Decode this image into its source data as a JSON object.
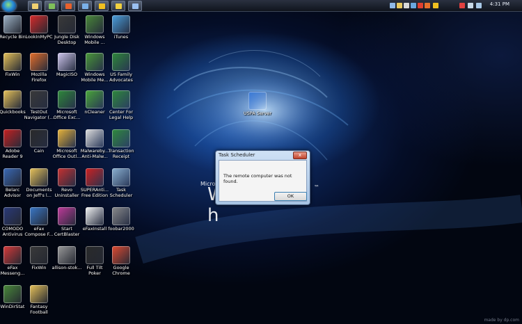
{
  "taskbar": {
    "clock": "4:31 PM",
    "quick_launch": [
      {
        "name": "show-desktop",
        "icon": "desktop-icon",
        "color": "#f0d070"
      },
      {
        "name": "mycomputer",
        "icon": "computer-icon",
        "color": "#7fc05a"
      },
      {
        "name": "firefox",
        "icon": "firefox-icon",
        "color": "#e8612c"
      },
      {
        "name": "ftp",
        "icon": "network-icon",
        "color": "#7ab0e8"
      },
      {
        "name": "runner",
        "icon": "runner-icon",
        "color": "#f0c020"
      },
      {
        "name": "favorites",
        "icon": "star-icon",
        "color": "#f0d040"
      },
      {
        "name": "switch-windows",
        "icon": "windows-icon",
        "color": "#9ac0f0"
      }
    ],
    "tray": [
      {
        "icon": "monitor-icon",
        "color": "#8fb8e8"
      },
      {
        "icon": "folder-icon",
        "color": "#e8c860"
      },
      {
        "icon": "document-icon",
        "color": "#d8d8d8"
      },
      {
        "icon": "network-icon",
        "color": "#6aa8e0"
      },
      {
        "icon": "chrome-icon",
        "color": "#e04030"
      },
      {
        "icon": "firefox-icon",
        "color": "#e8702c"
      },
      {
        "icon": "runner-icon",
        "color": "#f0c020"
      },
      {
        "icon": "flag-icon",
        "color": "#e04040"
      },
      {
        "icon": "speaker-icon",
        "color": "#c8d8e8"
      },
      {
        "icon": "network-tray-icon",
        "color": "#a8c8e8"
      }
    ]
  },
  "desktop": {
    "icons": [
      {
        "label1": "Recycle Bin",
        "label2": "",
        "icon": "recycle-bin-icon",
        "color": "#9fb4c8"
      },
      {
        "label1": "LookInMyPC",
        "label2": "",
        "icon": "lookinmypc-icon",
        "color": "#d92a2a"
      },
      {
        "label1": "Jungle Disk",
        "label2": "Desktop",
        "icon": "jungle-disk-icon",
        "color": "#3a3a3a"
      },
      {
        "label1": "Windows",
        "label2": "Mobile ...",
        "icon": "windows-mobile-icon",
        "color": "#4a8a3a"
      },
      {
        "label1": "iTunes",
        "label2": "",
        "icon": "itunes-icon",
        "color": "#4aa0e0"
      },
      {
        "label1": "FixWin",
        "label2": "",
        "icon": "folder-icon",
        "color": "#e8c35a"
      },
      {
        "label1": "Mozilla",
        "label2": "Firefox",
        "icon": "firefox-icon",
        "color": "#e8702c"
      },
      {
        "label1": "MagicISO",
        "label2": "",
        "icon": "magiciso-icon",
        "color": "#d0c8f0"
      },
      {
        "label1": "Windows",
        "label2": "Mobile Me...",
        "icon": "windows-mobile-icon",
        "color": "#4a9a3a"
      },
      {
        "label1": "US Family",
        "label2": "Advocates",
        "icon": "excel-icon",
        "color": "#2f8a3c"
      },
      {
        "label1": "Quickbooks",
        "label2": "",
        "icon": "folder-icon",
        "color": "#e8c35a"
      },
      {
        "label1": "TestOut",
        "label2": "Navigator (...",
        "icon": "testout-icon",
        "color": "#3a3a3a"
      },
      {
        "label1": "Microsoft",
        "label2": "Office Exc...",
        "icon": "excel-icon",
        "color": "#2f8a3c"
      },
      {
        "label1": "nCleaner",
        "label2": "",
        "icon": "ncleaner-icon",
        "color": "#4aa83a"
      },
      {
        "label1": "Center For",
        "label2": "Legal Help",
        "icon": "excel-icon",
        "color": "#2f8a3c"
      },
      {
        "label1": "Adobe",
        "label2": "Reader 9",
        "icon": "adobe-reader-icon",
        "color": "#c82020"
      },
      {
        "label1": "Cain",
        "label2": "",
        "icon": "cain-icon",
        "color": "#2a2a2a"
      },
      {
        "label1": "Microsoft",
        "label2": "Office Outl...",
        "icon": "outlook-icon",
        "color": "#e8b43a"
      },
      {
        "label1": "Malwareby...",
        "label2": "Anti-Malw...",
        "icon": "malwarebytes-icon",
        "color": "#e0e0e0"
      },
      {
        "label1": "Transaction",
        "label2": "Receipt",
        "icon": "excel-icon",
        "color": "#2f8a3c"
      },
      {
        "label1": "Belarc",
        "label2": "Advisor",
        "icon": "belarc-icon",
        "color": "#3a6ab8"
      },
      {
        "label1": "Documents",
        "label2": "on Jeff's l...",
        "icon": "folder-icon",
        "color": "#e8c35a"
      },
      {
        "label1": "Revo",
        "label2": "Uninstaller",
        "icon": "revo-icon",
        "color": "#c83030"
      },
      {
        "label1": "SUPERAnti...",
        "label2": "Free Edition",
        "icon": "superantispyware-icon",
        "color": "#d02020"
      },
      {
        "label1": "Task",
        "label2": "Scheduler",
        "icon": "task-scheduler-icon",
        "color": "#8ab0d0"
      },
      {
        "label1": "COMODO",
        "label2": "Antivirus",
        "icon": "comodo-icon",
        "color": "#2a3a7a"
      },
      {
        "label1": "eFax",
        "label2": "Compose F...",
        "icon": "efax-icon",
        "color": "#3a78c8"
      },
      {
        "label1": "Start",
        "label2": "CertBlaster",
        "icon": "certblaster-icon",
        "color": "#c03a9a"
      },
      {
        "label1": "eFaxInstall",
        "label2": "",
        "icon": "document-icon",
        "color": "#f4f4f4"
      },
      {
        "label1": "foobar2000",
        "label2": "",
        "icon": "foobar-icon",
        "color": "#8a8a8a"
      },
      {
        "label1": "eFax",
        "label2": "Messeng...",
        "icon": "efax-messenger-icon",
        "color": "#d83a3a"
      },
      {
        "label1": "FixWin",
        "label2": "",
        "icon": "fixwin-icon",
        "color": "#3a3a3a"
      },
      {
        "label1": "allison-stok...",
        "label2": "",
        "icon": "image-icon",
        "color": "#9a9a9a"
      },
      {
        "label1": "Full Tilt",
        "label2": "Poker",
        "icon": "full-tilt-icon",
        "color": "#2a2a2a"
      },
      {
        "label1": "Google",
        "label2": "Chrome",
        "icon": "chrome-icon",
        "color": "#e04a30"
      },
      {
        "label1": "WinDirStat",
        "label2": "",
        "icon": "windirstat-icon",
        "color": "#4a8a3a"
      },
      {
        "label1": "Fantasy",
        "label2": "Football",
        "icon": "folder-icon",
        "color": "#e8c35a"
      },
      {
        "label1": "USPA Server",
        "label2": "",
        "icon": "computer-icon",
        "color": "#3a7ad8"
      }
    ]
  },
  "wallpaper": {
    "brand_small": "Micro",
    "brand_big": "W                h",
    "trademark": "™"
  },
  "dialog": {
    "title": "Task Scheduler",
    "close_glyph": "x",
    "message": "The remote computer was not found.",
    "ok_label": "OK"
  },
  "watermark": "made by dp.com"
}
